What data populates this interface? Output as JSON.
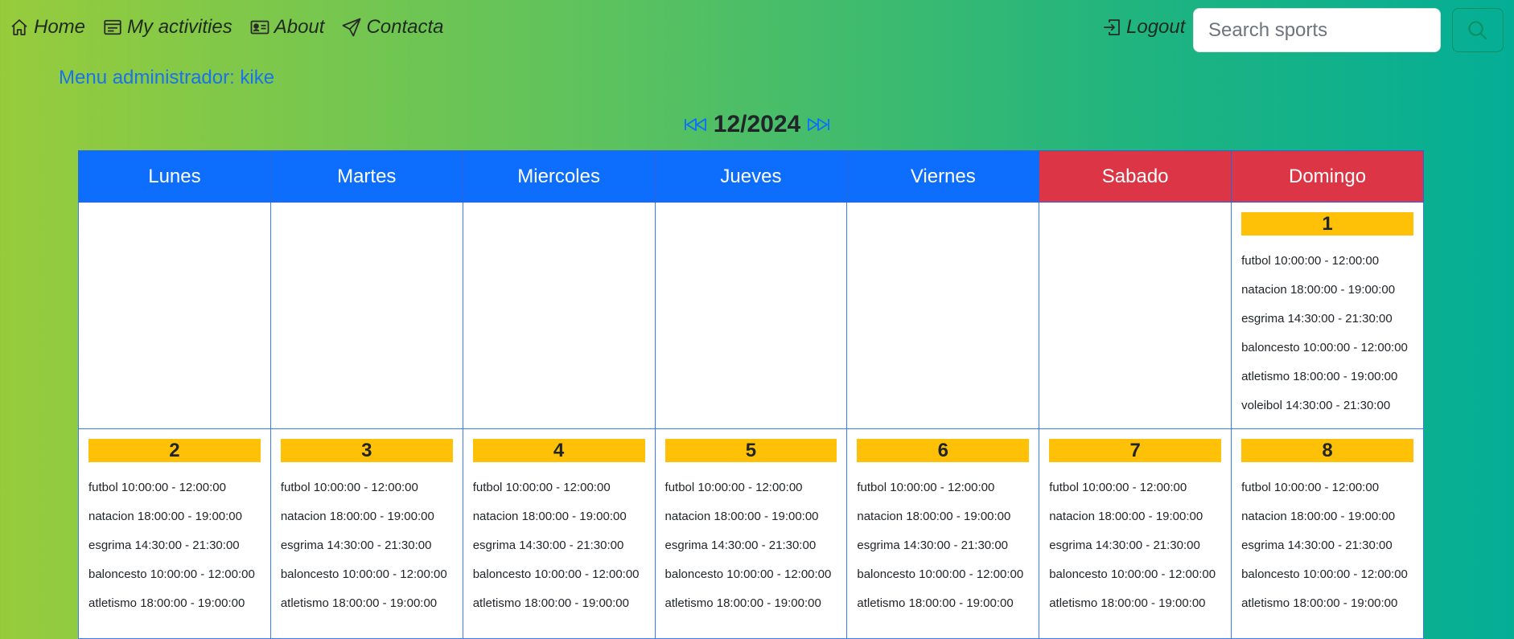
{
  "nav": {
    "home": "Home",
    "my_activities": "My activities",
    "about": "About",
    "contact": "Contacta",
    "logout": "Logout",
    "search_placeholder": "Search sports"
  },
  "admin_menu": "Menu administrador: kike",
  "calendar": {
    "month_label": "12/2024",
    "headers": [
      "Lunes",
      "Martes",
      "Miercoles",
      "Jueves",
      "Viernes",
      "Sabado",
      "Domingo"
    ],
    "day1": {
      "number": "1",
      "activities": [
        "futbol 10:00:00 - 12:00:00",
        "natacion 18:00:00 - 19:00:00",
        "esgrima 14:30:00 - 21:30:00",
        "baloncesto 10:00:00 - 12:00:00",
        "atletismo 18:00:00 - 19:00:00",
        "voleibol 14:30:00 - 21:30:00"
      ]
    },
    "week2": [
      {
        "number": "2"
      },
      {
        "number": "3"
      },
      {
        "number": "4"
      },
      {
        "number": "5"
      },
      {
        "number": "6"
      },
      {
        "number": "7"
      },
      {
        "number": "8"
      }
    ],
    "week2_activities": [
      "futbol 10:00:00 - 12:00:00",
      "natacion 18:00:00 - 19:00:00",
      "esgrima 14:30:00 - 21:30:00",
      "baloncesto 10:00:00 - 12:00:00",
      "atletismo 18:00:00 - 19:00:00"
    ]
  },
  "colors": {
    "weekday_header": "#0d6efd",
    "weekend_header": "#dc3545",
    "day_number_bg": "#ffc107",
    "admin_link": "#1a73e8"
  },
  "icons": {
    "home": "house-icon",
    "my_activities": "card-list-icon",
    "about": "person-vcard-icon",
    "contact": "send-icon",
    "logout": "box-arrow-in-right-icon",
    "search": "search-icon",
    "prev_month": "skip-backward-icon",
    "next_month": "skip-forward-icon"
  }
}
